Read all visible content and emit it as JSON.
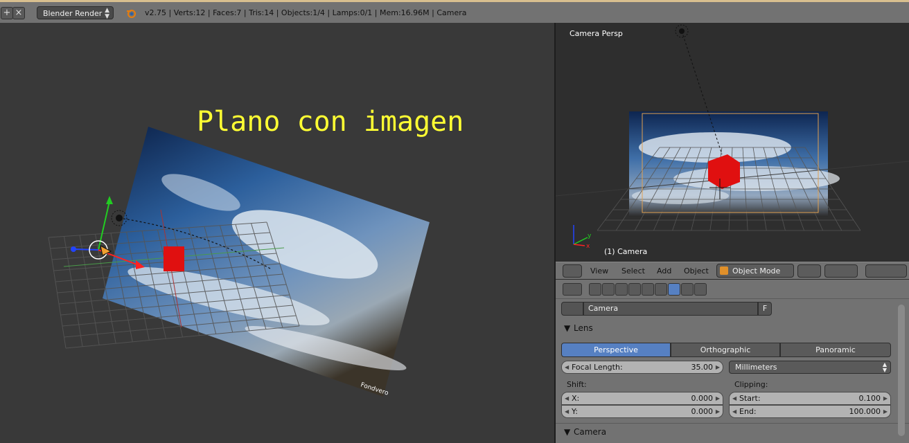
{
  "topbar": {
    "engine": "Blender Render",
    "stats": "v2.75 | Verts:12 | Faces:7 | Tris:14 | Objects:1/4 | Lamps:0/1 | Mem:16.96M | Camera"
  },
  "left_view": {
    "overlay_text": "Plano con imagen",
    "image_credit": "Fondvero"
  },
  "right_view": {
    "view_name": "Camera Persp",
    "object_label": "(1) Camera"
  },
  "view_header": {
    "menus": [
      "View",
      "Select",
      "Add",
      "Object"
    ],
    "mode": "Object Mode"
  },
  "properties": {
    "datablock_name": "Camera",
    "fake_user": "F",
    "lens_panel": {
      "title": "Lens",
      "types": [
        "Perspective",
        "Orthographic",
        "Panoramic"
      ],
      "active_type": "Perspective",
      "focal_length_label": "Focal Length:",
      "focal_length_value": "35.00",
      "unit": "Millimeters",
      "shift_label": "Shift:",
      "shift_x_label": "X:",
      "shift_x_value": "0.000",
      "shift_y_label": "Y:",
      "shift_y_value": "0.000",
      "clipping_label": "Clipping:",
      "clip_start_label": "Start:",
      "clip_start_value": "0.100",
      "clip_end_label": "End:",
      "clip_end_value": "100.000"
    },
    "camera_panel": {
      "title": "Camera"
    }
  },
  "colors": {
    "overlay_text": "#ffff33",
    "accent": "#5680c2",
    "viewport_bg": "#393939",
    "header_bg": "#727272"
  }
}
